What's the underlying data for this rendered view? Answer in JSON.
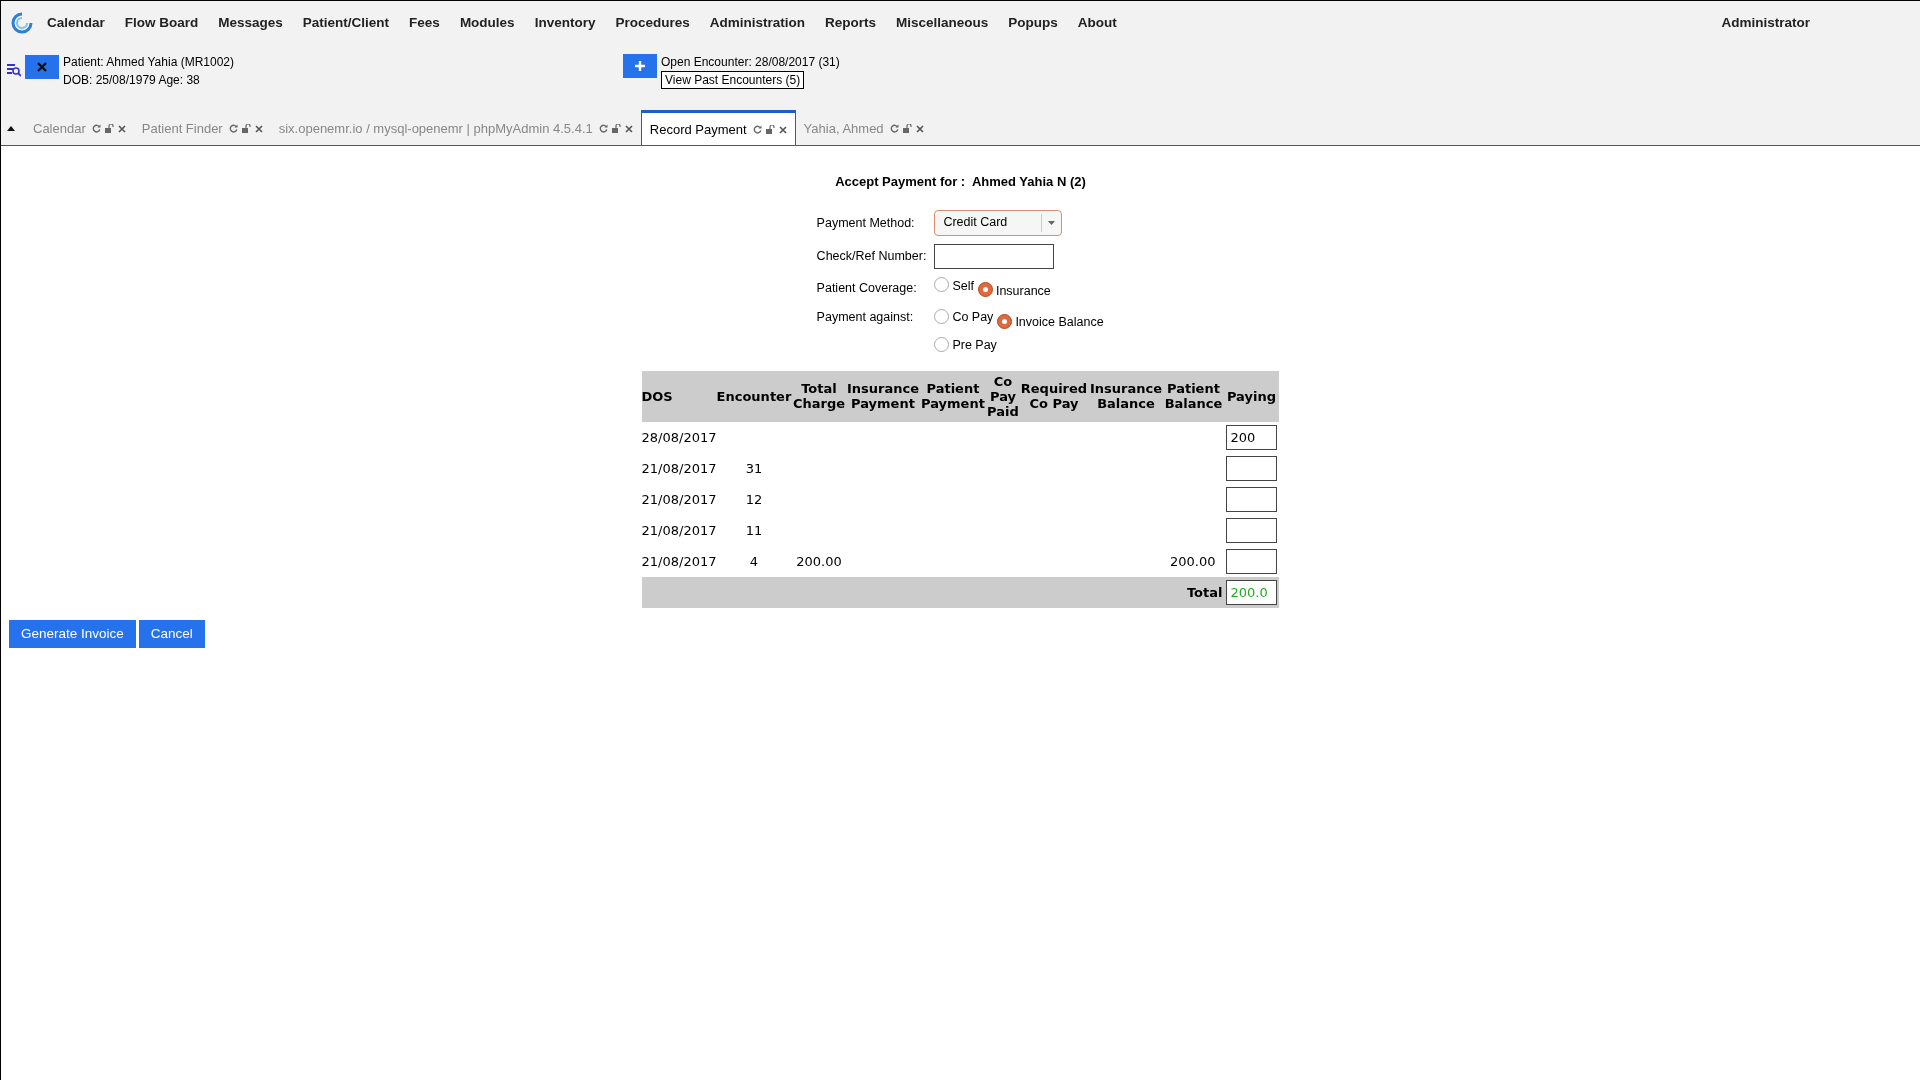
{
  "menu": {
    "items": [
      "Calendar",
      "Flow Board",
      "Messages",
      "Patient/Client",
      "Fees",
      "Modules",
      "Inventory",
      "Procedures",
      "Administration",
      "Reports",
      "Miscellaneous",
      "Popups",
      "About"
    ],
    "user": "Administrator"
  },
  "patient": {
    "name_line": "Patient: Ahmed Yahia (MR1002)",
    "dob_line": "DOB: 25/08/1979 Age: 38"
  },
  "encounter": {
    "open_line": "Open Encounter: 28/08/2017 (31)",
    "past_button": "View Past Encounters (5)"
  },
  "tabs": [
    {
      "label": "Calendar",
      "selected": false
    },
    {
      "label": "Patient Finder",
      "selected": false
    },
    {
      "label": "six.openemr.io / mysql-openemr | phpMyAdmin 4.5.4.1",
      "selected": false
    },
    {
      "label": "Record Payment",
      "selected": true
    },
    {
      "label": "Yahia, Ahmed",
      "selected": false
    }
  ],
  "form": {
    "title": "Accept Payment for :  Ahmed Yahia N (2)",
    "payment_method": {
      "label": "Payment Method:",
      "value": "Credit Card"
    },
    "check_ref": {
      "label": "Check/Ref Number:"
    },
    "coverage": {
      "label": "Patient Coverage:",
      "options": [
        {
          "label": "Self",
          "selected": false
        },
        {
          "label": "Insurance",
          "selected": true
        }
      ]
    },
    "against": {
      "label": "Payment against:",
      "options": [
        {
          "label": "Co Pay",
          "selected": false
        },
        {
          "label": "Invoice Balance",
          "selected": true
        },
        {
          "label": "Pre Pay",
          "selected": false
        }
      ]
    }
  },
  "table": {
    "columns": [
      "DOS",
      "Encounter",
      "Total Charge",
      "Insurance Payment",
      "Patient Payment",
      "Co Pay Paid",
      "Required Co Pay",
      "Insurance Balance",
      "Patient Balance",
      "Paying"
    ],
    "rows": [
      {
        "dos": "28/08/2017",
        "paying": "200"
      },
      {
        "dos": "21/08/2017",
        "encounter": "31"
      },
      {
        "dos": "21/08/2017",
        "encounter": "12"
      },
      {
        "dos": "21/08/2017",
        "encounter": "11"
      },
      {
        "dos": "21/08/2017",
        "encounter": "4",
        "total_charge": "200.00",
        "patient_balance": "200.00"
      }
    ],
    "total_label": "Total",
    "total_value": "200.0"
  },
  "buttons": [
    "Generate Invoice",
    "Cancel"
  ]
}
